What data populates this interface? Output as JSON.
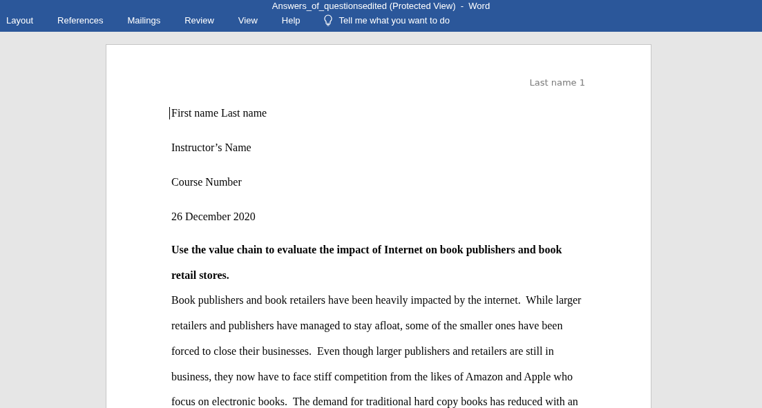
{
  "window": {
    "title": "Answers_of_questionsedited (Protected View)  -  Word"
  },
  "menu": [
    {
      "label": "Layout"
    },
    {
      "label": "References"
    },
    {
      "label": "Mailings"
    },
    {
      "label": "Review"
    },
    {
      "label": "View"
    },
    {
      "label": "Help"
    }
  ],
  "tell_me": {
    "placeholder": "Tell me what you want to do"
  },
  "document": {
    "header": "Last name 1",
    "lines": [
      "First name Last name",
      "Instructor’s Name",
      "Course Number",
      "26 December 2020"
    ],
    "heading": "Use the value chain to evaluate the impact of Internet on book publishers and book retail stores.",
    "body": "Book publishers and book retailers have been heavily impacted by the internet.  While larger retailers and publishers have managed to stay afloat, some of the smaller ones have been forced to close their businesses.  Even though larger publishers and retailers are still in business, they now have to face stiff competition from the likes of Amazon and Apple who focus on electronic books.  The demand for traditional hard copy books has reduced with an"
  }
}
